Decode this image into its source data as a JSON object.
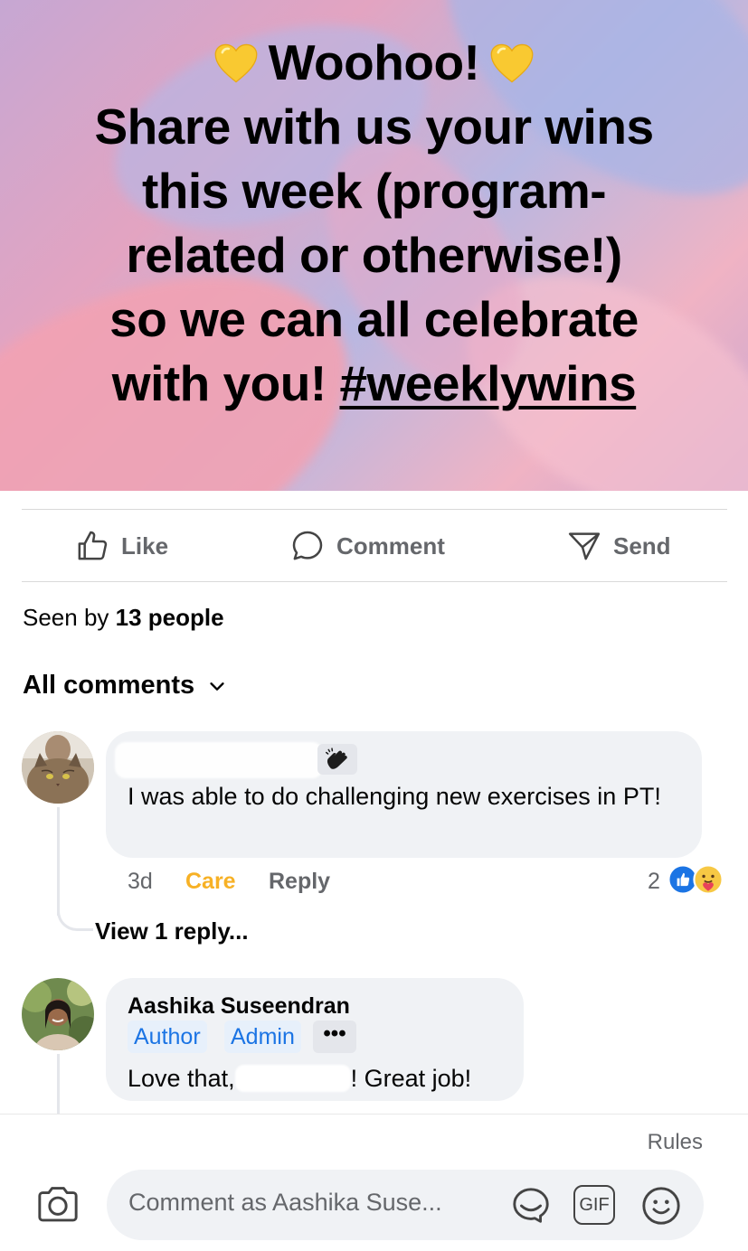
{
  "post": {
    "line1": "Woohoo!",
    "line2": "Share with us your wins",
    "line3": "this week (program-",
    "line4": "related or otherwise!)",
    "line5": "so we can all celebrate",
    "line6_prefix": "with you! ",
    "hashtag": "#weeklywins",
    "heart_icon": "yellow-heart-emoji",
    "heart_color": "#f9c931"
  },
  "actions": {
    "like": "Like",
    "comment": "Comment",
    "send": "Send"
  },
  "seen": {
    "prefix": "Seen by ",
    "count": "13 people"
  },
  "comments_filter": {
    "label": "All comments"
  },
  "comment1": {
    "author_redacted": true,
    "wave_icon": "waving-hand-icon",
    "text": "I was able to do challenging new exercises in PT!",
    "time": "3d",
    "reaction_label": "Care",
    "reply_label": "Reply",
    "reaction_count": "2",
    "reaction_icons": [
      "like-reaction-icon",
      "care-reaction-icon"
    ],
    "view_replies": "View 1 reply..."
  },
  "comment2": {
    "author": "Aashika Suseendran",
    "badges": [
      "Author",
      "Admin"
    ],
    "more": "•••",
    "text_before": "Love that,",
    "text_after": "! Great job!"
  },
  "composer": {
    "rules": "Rules",
    "placeholder": "Comment as Aashika Suse...",
    "icons": [
      "camera-icon",
      "sticker-icon",
      "gif-icon",
      "emoji-icon"
    ],
    "gif_label": "GIF"
  },
  "colors": {
    "accent": "#1b74e4",
    "care": "#f7b125",
    "muted": "#65676b",
    "bubble": "#f0f2f5"
  }
}
